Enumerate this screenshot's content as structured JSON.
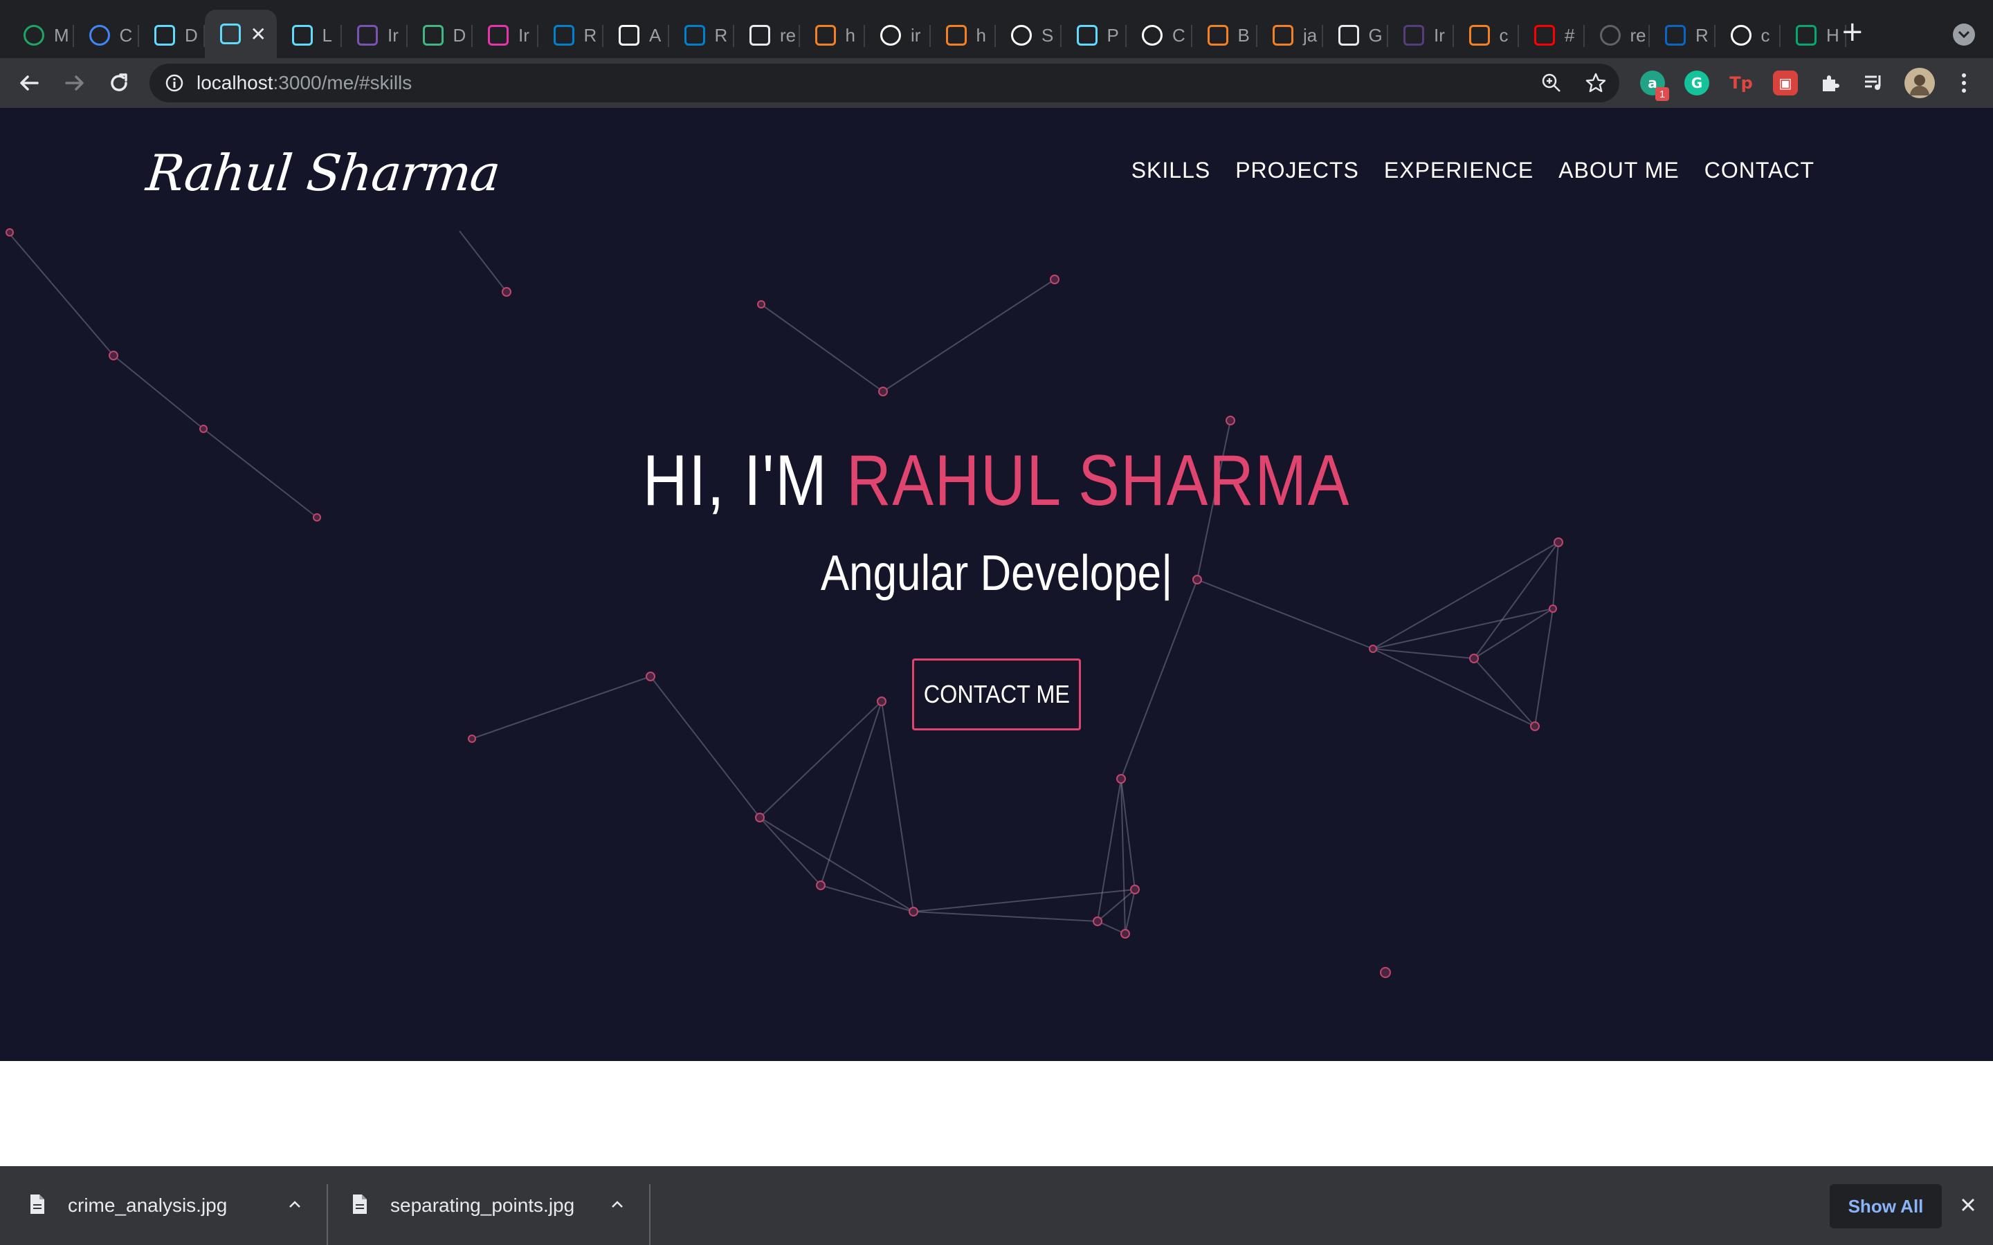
{
  "browser": {
    "tabs": [
      {
        "letter": "M",
        "icon": "google-drive-icon",
        "color": "#1fa463"
      },
      {
        "letter": "C",
        "icon": "google-docs-icon",
        "color": "#4285f4"
      },
      {
        "letter": "D",
        "icon": "react-icon",
        "color": "#61dafb"
      },
      {
        "letter": "",
        "icon": "react-icon",
        "color": "#61dafb",
        "active": true
      },
      {
        "letter": "L",
        "icon": "react-icon",
        "color": "#61dafb"
      },
      {
        "letter": "Ir",
        "icon": "bootstrap-icon",
        "color": "#7952b3"
      },
      {
        "letter": "D",
        "icon": "vuetify-icon",
        "color": "#41b883"
      },
      {
        "letter": "Ir",
        "icon": "graphql-icon",
        "color": "#e535ab"
      },
      {
        "letter": "R",
        "icon": "material-ui-icon",
        "color": "#0081cb"
      },
      {
        "letter": "A",
        "icon": "amazon-icon",
        "color": "#ffffff"
      },
      {
        "letter": "R",
        "icon": "material-ui-icon",
        "color": "#0081cb"
      },
      {
        "letter": "re",
        "icon": "codesandbox-icon",
        "color": "#e8eaed"
      },
      {
        "letter": "h",
        "icon": "stackoverflow-icon",
        "color": "#f48024"
      },
      {
        "letter": "ir",
        "icon": "google-icon",
        "color": "#ffffff"
      },
      {
        "letter": "h",
        "icon": "stackoverflow-icon",
        "color": "#f48024"
      },
      {
        "letter": "S",
        "icon": "github-icon",
        "color": "#ffffff"
      },
      {
        "letter": "P",
        "icon": "react-icon",
        "color": "#61dafb"
      },
      {
        "letter": "C",
        "icon": "github-icon",
        "color": "#ffffff"
      },
      {
        "letter": "B",
        "icon": "stackoverflow-icon",
        "color": "#f48024"
      },
      {
        "letter": "ja",
        "icon": "stackoverflow-icon",
        "color": "#f48024"
      },
      {
        "letter": "G",
        "icon": "key-icon",
        "color": "#e8eaed"
      },
      {
        "letter": "Ir",
        "icon": "bootstrap-icon",
        "color": "#563d7c"
      },
      {
        "letter": "c",
        "icon": "stackoverflow-icon",
        "color": "#f48024"
      },
      {
        "letter": "#",
        "icon": "youtube-icon",
        "color": "#ff0000"
      },
      {
        "letter": "re",
        "icon": "globe-icon",
        "color": "#5f6368"
      },
      {
        "letter": "R",
        "icon": "linkedin-icon",
        "color": "#0a66c2"
      },
      {
        "letter": "c",
        "icon": "github-icon",
        "color": "#ffffff"
      },
      {
        "letter": "H",
        "icon": "w3schools-icon",
        "color": "#04aa6d"
      }
    ],
    "url_host": "localhost",
    "url_path": ":3000/me/#skills",
    "extension_badge": "1"
  },
  "site": {
    "logo": "Rahul Sharma",
    "nav": [
      "SKILLS",
      "PROJECTS",
      "EXPERIENCE",
      "ABOUT ME",
      "CONTACT"
    ],
    "greeting": "HI, I'M ",
    "name": "RAHUL SHARMA",
    "typed_role": "Angular Develope|",
    "cta": "CONTACT ME",
    "colors": {
      "background": "#151529",
      "accent": "#e0456f",
      "text": "#ffffff"
    }
  },
  "downloads": {
    "items": [
      "crime_analysis.jpg",
      "separating_points.jpg"
    ],
    "show_all": "Show All"
  }
}
